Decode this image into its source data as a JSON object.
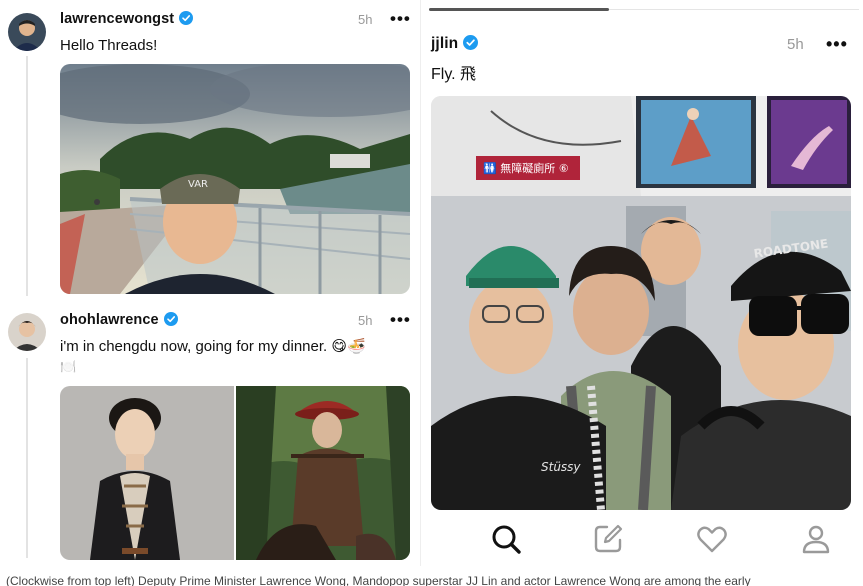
{
  "posts": [
    {
      "username": "lawrencewongst",
      "time": "5h",
      "text": "Hello Threads!"
    },
    {
      "username": "ohohlawrence",
      "time": "5h",
      "text": "i'm in chengdu now, going for my dinner. 😋🍜",
      "text_line2": "🍽️"
    }
  ],
  "right_post": {
    "username": "jjlin",
    "time": "5h",
    "text": "Fly. 飛",
    "photo_signs": {
      "airport_sign": "🚻 無障礙廁所 ⑥",
      "cap_text": "ROADTONE"
    }
  },
  "photo_text": {
    "cap_label": "VAR"
  },
  "nav": {
    "icons": [
      "search-icon",
      "compose-icon",
      "heart-icon",
      "profile-icon"
    ]
  },
  "caption": "(Clockwise from top left) Deputy Prime Minister Lawrence Wong, Mandopop superstar JJ Lin and actor Lawrence Wong are among the early",
  "colors": {
    "verified": "#1d9bf0",
    "accent_sign": "#b0243a"
  }
}
